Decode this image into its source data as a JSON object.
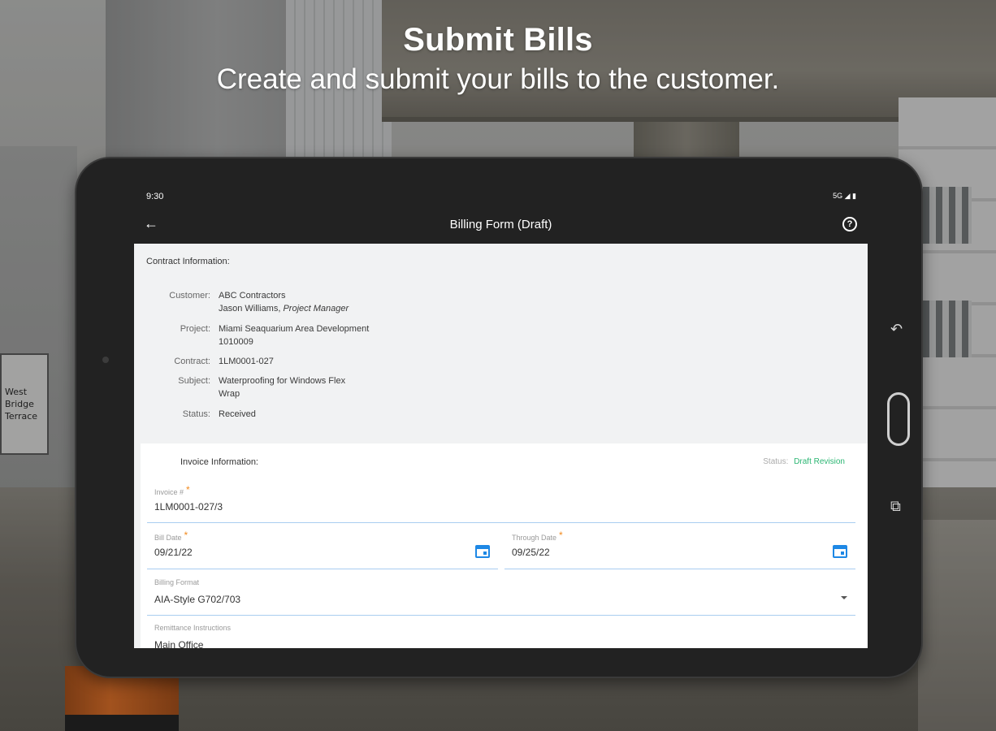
{
  "headline": {
    "title": "Submit Bills",
    "subtitle": "Create and submit your bills to the customer."
  },
  "background_sign": "West\nBridge\nTerrace",
  "statusbar": {
    "time": "9:30",
    "network": "5G"
  },
  "appbar": {
    "title": "Billing Form (Draft)",
    "back_icon": "arrow-left-icon",
    "help_icon": "help-circle-icon"
  },
  "contract": {
    "heading": "Contract Information:",
    "customer_label": "Customer:",
    "customer_name": "ABC Contractors",
    "customer_contact": "Jason Williams,",
    "customer_role": "Project Manager",
    "project_label": "Project:",
    "project_name": "Miami Seaquarium Area Development",
    "project_number": "1010009",
    "contract_label": "Contract:",
    "contract_value": "1LM0001-027",
    "subject_label": "Subject:",
    "subject_value": "Waterproofing for Windows Flex Wrap",
    "status_label": "Status:",
    "status_value": "Received"
  },
  "invoice": {
    "heading": "Invoice Information:",
    "status_label": "Status:",
    "status_value": "Draft Revision",
    "status_color": "#2bb673",
    "invoice_number": {
      "label": "Invoice #",
      "value": "1LM0001-027/3",
      "required": "*"
    },
    "bill_date": {
      "label": "Bill Date",
      "value": "09/21/22",
      "required": "*",
      "icon": "calendar-icon"
    },
    "through_date": {
      "label": "Through Date",
      "value": "09/25/22",
      "required": "*",
      "icon": "calendar-icon"
    },
    "billing_format": {
      "label": "Billing Format",
      "value": "AIA-Style G702/703",
      "icon": "dropdown-caret-icon"
    },
    "remittance": {
      "label": "Remittance Instructions",
      "value": "Main Office"
    }
  },
  "colors": {
    "appbar": "#222222",
    "accent": "#1e88e5",
    "required": "#f28a1e"
  }
}
